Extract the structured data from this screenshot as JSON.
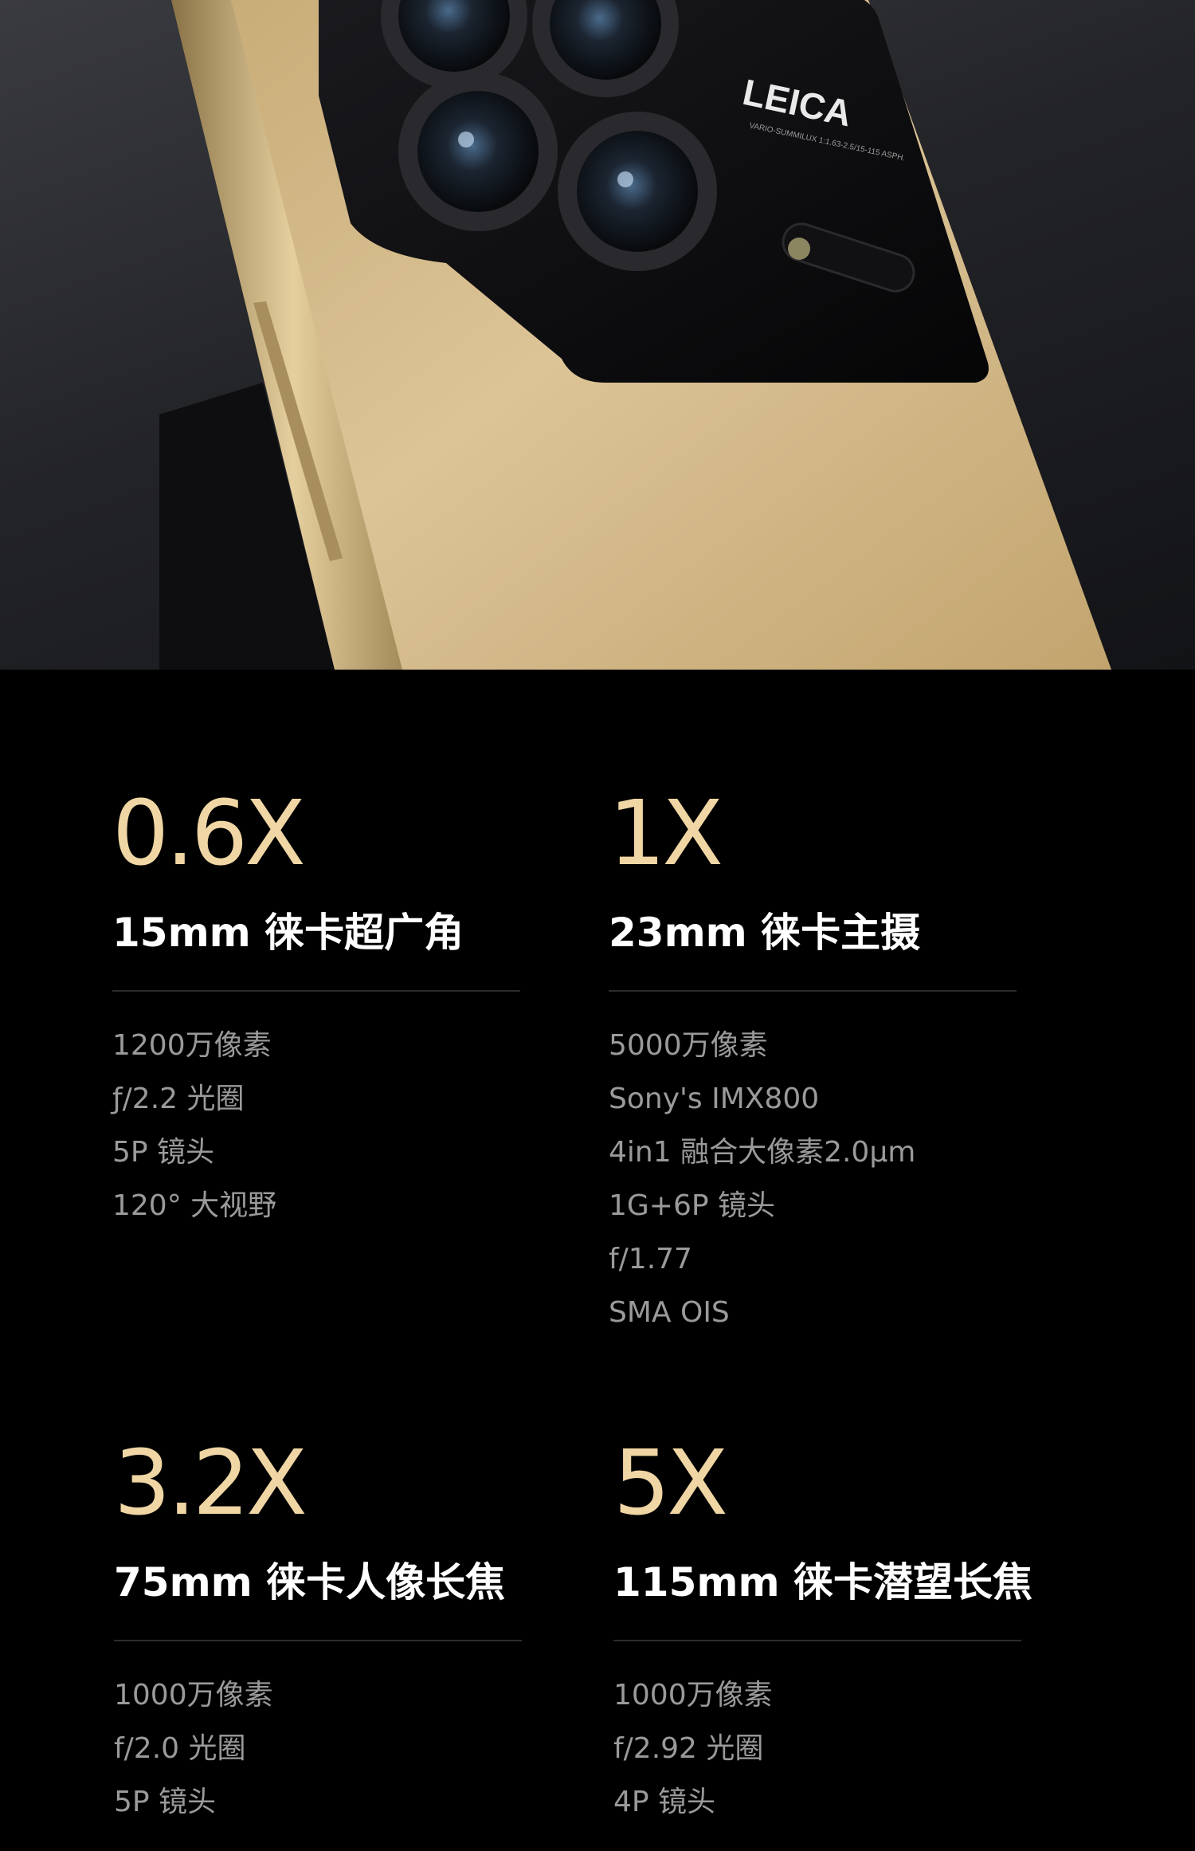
{
  "hero": {
    "logo_text": "LEICA",
    "logo_subtext": "VARIO-SUMMILUX 1:1.63-2.5/15-115 ASPH.",
    "colors": {
      "body": "#d8bf8e",
      "frame": "#b59a66",
      "camera_island": "#0b0b0d",
      "background": "#232428"
    }
  },
  "colors": {
    "accent_gold": "#f0d6a4",
    "title": "#ffffff",
    "spec_text": "#9a9a9a",
    "divider": "#2c2c2c",
    "background": "#000000"
  },
  "lenses": [
    {
      "zoom": "0.6X",
      "title": "15mm 徕卡超广角",
      "specs": [
        "1200万像素",
        "ƒ/2.2 光圈",
        "5P 镜头",
        "120° 大视野"
      ]
    },
    {
      "zoom": "1X",
      "title": "23mm 徕卡主摄",
      "specs": [
        "5000万像素",
        "Sony's IMX800",
        "4in1 融合大像素2.0μm",
        "1G+6P 镜头",
        "f/1.77",
        "SMA OIS"
      ]
    },
    {
      "zoom": "3.2X",
      "title": "75mm 徕卡人像长焦",
      "specs": [
        "1000万像素",
        "f/2.0 光圈",
        "5P 镜头"
      ]
    },
    {
      "zoom": "5X",
      "title": "115mm 徕卡潜望长焦",
      "specs": [
        "1000万像素",
        "f/2.92 光圈",
        "4P 镜头"
      ]
    }
  ]
}
